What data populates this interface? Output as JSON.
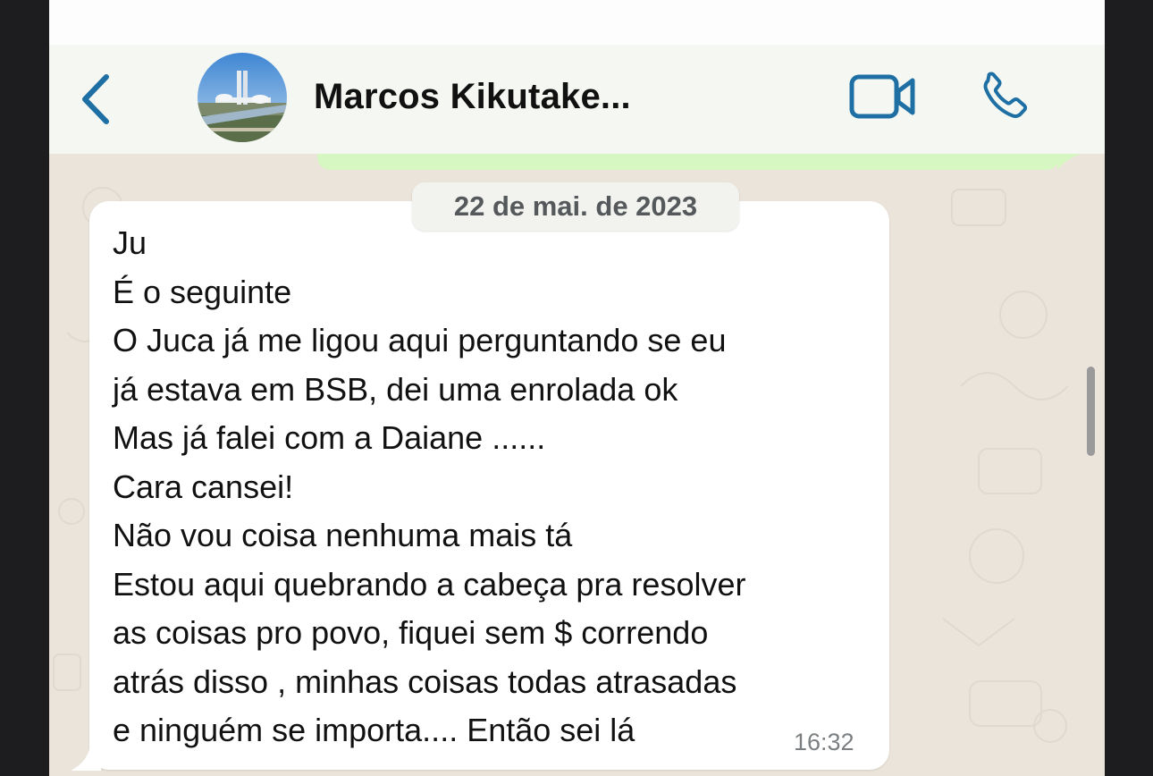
{
  "header": {
    "contact_name": "Marcos Kikutake...",
    "back_icon": "chevron-left-icon",
    "video_icon": "video-camera-icon",
    "call_icon": "phone-icon"
  },
  "chat": {
    "date_separator": "22 de mai. de 2023",
    "message": {
      "lines": [
        "Ju",
        "É o seguinte",
        "O Juca já me ligou aqui perguntando se eu",
        "já estava em BSB, dei uma enrolada ok",
        "Mas já falei com a Daiane ......",
        "Cara cansei!",
        "Não vou coisa nenhuma mais tá",
        "Estou aqui quebrando a cabeça pra resolver",
        "as coisas pro povo, fiquei sem $ correndo",
        "atrás disso , minhas coisas todas atrasadas",
        "e ninguém se importa.... Então sei lá"
      ],
      "time": "16:32"
    }
  },
  "colors": {
    "accent": "#1e6fa3",
    "header_bg": "#f5f8f2",
    "chat_bg": "#ebe4da",
    "incoming_bubble": "#ffffff",
    "outgoing_bubble": "#d6f7c2"
  }
}
